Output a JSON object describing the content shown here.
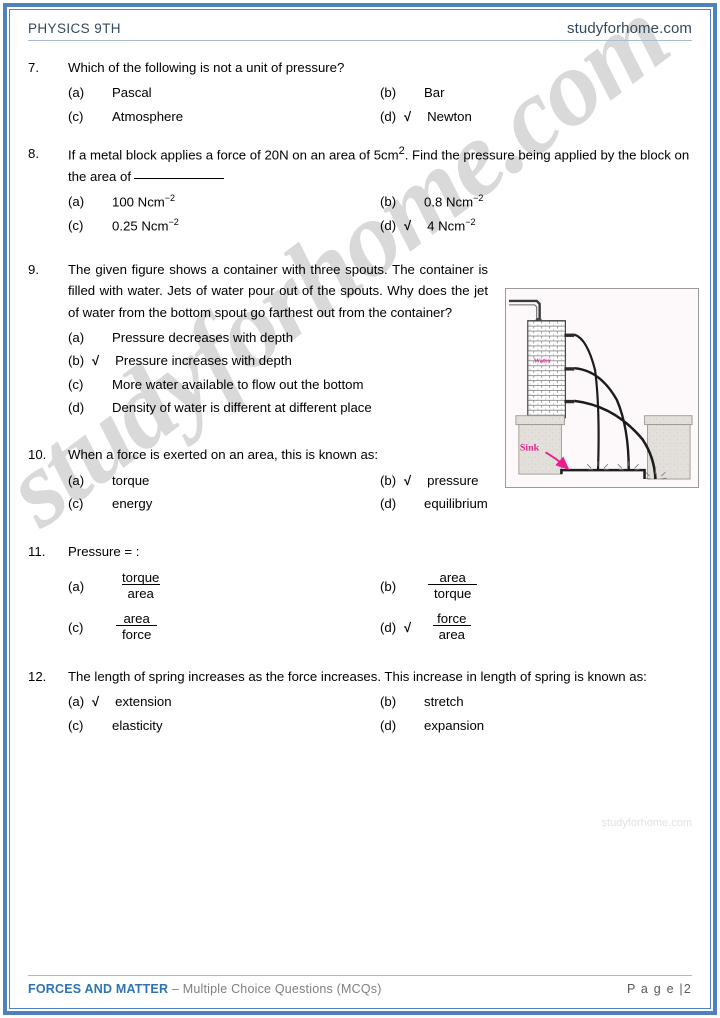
{
  "header": {
    "left": "PHYSICS 9TH",
    "right": "studyforhome.com"
  },
  "watermark": {
    "large": "studyforhome.com",
    "small": "studyforhome.com"
  },
  "colors": {
    "border_blue": "#4f81bd",
    "header_navy": "#34495e",
    "footer_chapter_blue": "#2e74b5",
    "footer_gray": "#808080",
    "tick_black": "#000000",
    "figure_pink": "#e5218f"
  },
  "tick_mark": "√",
  "questions": [
    {
      "number": "7.",
      "text": "Which of the following is not a unit of pressure?",
      "layout": "two-column",
      "options": [
        {
          "label": "(a)",
          "value": "Pascal",
          "correct": false
        },
        {
          "label": "(b)",
          "value": "Bar",
          "correct": false
        },
        {
          "label": "(c)",
          "value": "Atmosphere",
          "correct": false
        },
        {
          "label": "(d)",
          "value": "Newton",
          "correct": true
        }
      ]
    },
    {
      "number": "8.",
      "text_part1": "If a metal block applies a force of 20N on an area of 5cm",
      "text_sup": "2",
      "text_part2": ". Find the pressure being applied by the block on the area of",
      "has_blank": true,
      "layout": "two-column",
      "options": [
        {
          "label": "(a)",
          "value": "100 Ncm",
          "sup": "−2",
          "correct": false
        },
        {
          "label": "(b)",
          "value": "0.8 Ncm",
          "sup": "−2",
          "correct": false
        },
        {
          "label": "(c)",
          "value": "0.25 Ncm",
          "sup": "−2",
          "correct": false
        },
        {
          "label": "(d)",
          "value": "4 Ncm",
          "sup": "−2",
          "correct": true
        }
      ]
    },
    {
      "number": "9.",
      "text": "The given figure shows a container with three spouts. The container is filled with water. Jets of water pour out of the spouts. Why does the jet of water from the bottom spout go farthest out from the container?",
      "layout": "single-column-narrow",
      "options": [
        {
          "label": "(a)",
          "value": "Pressure decreases with depth",
          "correct": false
        },
        {
          "label": "(b)",
          "value": "Pressure increases with depth",
          "correct": true
        },
        {
          "label": "(c)",
          "value": "More water available to flow out the bottom",
          "correct": false
        },
        {
          "label": "(d)",
          "value": "Density of water is different at different place",
          "correct": false
        }
      ]
    },
    {
      "number": "10.",
      "text": "When a force is exerted on an area, this is known as:",
      "layout": "two-column",
      "options": [
        {
          "label": "(a)",
          "value": "torque",
          "correct": false
        },
        {
          "label": "(b)",
          "value": "pressure",
          "correct": true
        },
        {
          "label": "(c)",
          "value": "energy",
          "correct": false
        },
        {
          "label": "(d)",
          "value": "equilibrium",
          "correct": false
        }
      ]
    },
    {
      "number": "11.",
      "text": "Pressure = :",
      "layout": "two-column-fraction",
      "options": [
        {
          "label": "(a)",
          "numerator": "torque",
          "denominator": "area",
          "correct": false
        },
        {
          "label": "(b)",
          "numerator": "area",
          "denominator": "torque",
          "correct": false
        },
        {
          "label": "(c)",
          "numerator": "area",
          "denominator": "force",
          "correct": false
        },
        {
          "label": "(d)",
          "numerator": "force",
          "denominator": "area",
          "correct": true
        }
      ]
    },
    {
      "number": "12.",
      "text": "The length of spring increases as the force increases. This increase in length of spring is known as:",
      "layout": "two-column",
      "options": [
        {
          "label": "(a)",
          "value": "extension",
          "correct": true
        },
        {
          "label": "(b)",
          "value": "stretch",
          "correct": false
        },
        {
          "label": "(c)",
          "value": "elasticity",
          "correct": false
        },
        {
          "label": "(d)",
          "value": "expansion",
          "correct": false
        }
      ]
    }
  ],
  "figure": {
    "caption_water": "Water",
    "caption_sink": "Sink",
    "description": "container with three spouts and water jets into a sink"
  },
  "footer": {
    "chapter": "FORCES AND MATTER",
    "separator": "–",
    "subtitle": "Multiple Choice Questions (MCQs)",
    "page": "P a g e  |2"
  }
}
